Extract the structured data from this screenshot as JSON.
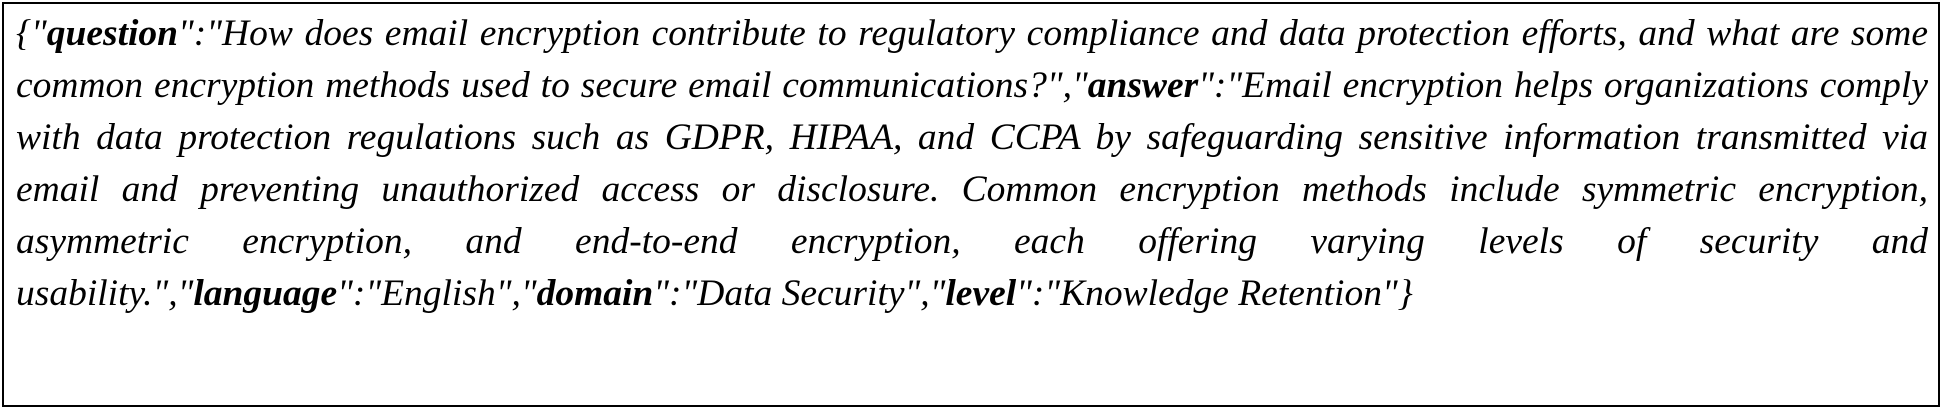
{
  "record": {
    "question_key": "question",
    "question": "How does email encryption contribute to regulatory compliance and data protection efforts, and what are some common encryption methods used to secure email communications?",
    "answer_key": "answer",
    "answer": "Email encryption helps organizations comply with data protection regulations such as GDPR, HIPAA, and CCPA by safeguarding sensitive information transmitted via email and preventing unauthorized access or disclosure. Common encryption methods include symmetric encryption, asymmetric encryption, and end-to-end encryption, each offering varying levels of security and usability.",
    "language_key": "language",
    "language": "English",
    "domain_key": "domain",
    "domain": "Data Security",
    "level_key": "level",
    "level": "Knowledge Retention"
  }
}
